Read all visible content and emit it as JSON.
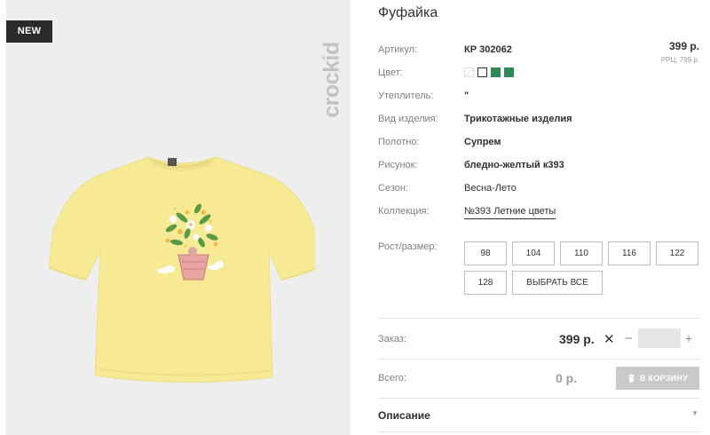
{
  "product": {
    "badge": "NEW",
    "brand_watermark": "crockid",
    "title": "Фуфайка",
    "attributes": [
      {
        "label": "Артикул:",
        "value": "КР 302062"
      },
      {
        "label": "Цвет:",
        "value": ""
      },
      {
        "label": "Утеплитель:",
        "value": "\""
      },
      {
        "label": "Вид изделия:",
        "value": "Трикотажные изделия"
      },
      {
        "label": "Полотно:",
        "value": "Супрем"
      },
      {
        "label": "Рисунок:",
        "value": "бледно-желтый к393"
      },
      {
        "label": "Сезон:",
        "value": "Весна-Лето"
      },
      {
        "label": "Коллекция:",
        "value": "№393 Летние цветы"
      }
    ],
    "price": "399 р.",
    "rrc_price": "РРЦ: 799 р.",
    "colors": [
      {
        "name": "unavailable",
        "hex": "#ffffff"
      },
      {
        "name": "selected",
        "hex": "#ffffff"
      },
      {
        "name": "green",
        "hex": "#2e8b57"
      },
      {
        "name": "green",
        "hex": "#2e8b57"
      }
    ]
  },
  "sizes": {
    "label": "Рост/размер:",
    "options": [
      "98",
      "104",
      "110",
      "116",
      "122",
      "128"
    ],
    "select_all": "ВЫБРАТЬ ВСЕ"
  },
  "order": {
    "label": "Заказ:",
    "price": "399 р.",
    "minus": "−",
    "plus": "+",
    "quantity_value": ""
  },
  "total": {
    "label": "Всего:",
    "value": "0 р.",
    "cart_button": "В КОРЗИНУ"
  },
  "description": {
    "title": "Описание"
  },
  "icons": {
    "remove": "close-icon",
    "cart": "trash-cart-icon",
    "expand": "chevron-down-icon"
  },
  "colors_ui": {
    "accent_green": "#2e8b57",
    "badge_bg": "#2a2a2a",
    "cart_button_bg": "#c9c9c9"
  }
}
